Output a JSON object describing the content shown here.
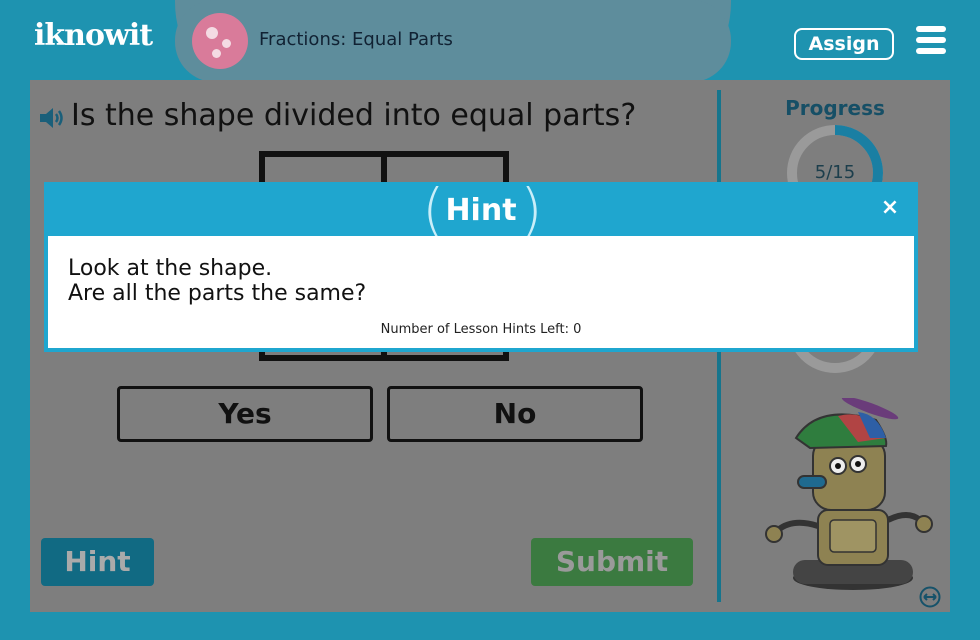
{
  "header": {
    "logo": "iknowit",
    "lesson_title": "Fractions: Equal Parts",
    "assign_label": "Assign",
    "menu_icon": "hamburger-menu-icon"
  },
  "question": {
    "speaker_icon": "speaker-icon",
    "text": "Is the shape divided into equal parts?"
  },
  "answers": [
    {
      "label": "Yes"
    },
    {
      "label": "No"
    }
  ],
  "actions": {
    "hint_label": "Hint",
    "submit_label": "Submit"
  },
  "progress": {
    "label": "Progress",
    "value_text": "5/15",
    "current": 5,
    "total": 15
  },
  "hint_modal": {
    "title": "Hint",
    "close_label": "×",
    "lines": [
      "Look at the shape.",
      "Are all the parts the same?"
    ],
    "hints_left": "Number of Lesson Hints Left: 0"
  },
  "colors": {
    "frame": "#1e93b0",
    "modal_header": "#1fa6cf",
    "submit": "#3b7a40",
    "hint": "#116a83"
  }
}
